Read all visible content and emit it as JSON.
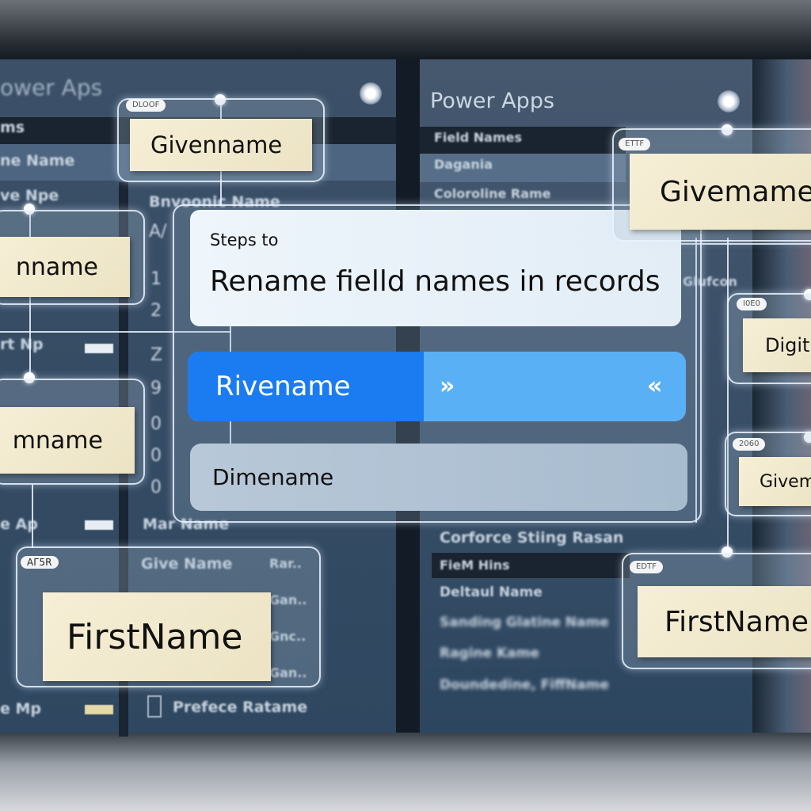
{
  "left_panel": {
    "title": "ower Aps",
    "rows": [
      "ms",
      "ne Name",
      "ve Npe",
      "rt Np",
      "e Ap",
      "e Mp"
    ],
    "column_labels": [
      "Bnvoonic Name",
      "Mar Name",
      "Give Name",
      "Prefece Ratame"
    ],
    "numbers": [
      "A/",
      "1",
      "2",
      "Z",
      "9",
      "0",
      "0",
      "0"
    ],
    "right_labels": [
      "Rar..",
      "Gan..",
      "Gnc..",
      "Gan.."
    ]
  },
  "right_panel": {
    "title": "Power Apps",
    "rows_top": [
      "Field Names",
      "Dagania",
      "Coloroline Rame"
    ],
    "side_label": "Glufcon",
    "rows_bottom": [
      "Corforce Stiing Rasan",
      "FieM Hins",
      "Deltaul Name",
      "Sanding Glatine Name",
      "Ragine Kame",
      "Doundedine, FiffName"
    ]
  },
  "cards": {
    "givenname_top": {
      "badge": "DLOOF",
      "label": "Givenname"
    },
    "left_nname": {
      "label": "nname"
    },
    "left_mname": {
      "label": "mname"
    },
    "firstname_left": {
      "badge": "AГ5R",
      "label": "FirstName"
    },
    "givemame_right": {
      "badge": "ETTF",
      "label": "Givemame"
    },
    "digitr_right": {
      "badge": "I0E0",
      "label": "Digitr"
    },
    "givem_right": {
      "badge": "2060",
      "label": "Givem"
    },
    "firstname_right": {
      "badge": "EDTF",
      "label": "FirstName"
    }
  },
  "dialog": {
    "subtitle": "Steps to",
    "title": "Rename fielld names  in records",
    "selected_option": "Rivename",
    "option2": "Dimename",
    "arrow_right": "»",
    "arrow_left": "«"
  },
  "colors": {
    "accent": "#1a7cf0",
    "accent_light": "#5ab0f5",
    "note": "#f4ecd0"
  }
}
